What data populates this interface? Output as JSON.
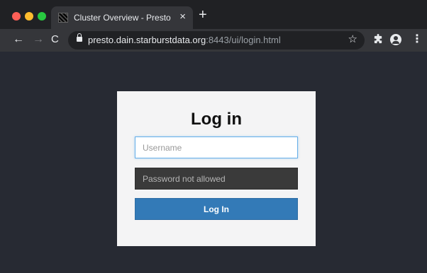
{
  "browser": {
    "tab": {
      "title": "Cluster Overview - Presto",
      "close_glyph": "×"
    },
    "new_tab_glyph": "+",
    "nav": {
      "back_glyph": "←",
      "forward_glyph": "→",
      "reload_glyph": "C"
    },
    "address": {
      "host": "presto.dain.starburstdata.org",
      "path": ":8443/ui/login.html"
    },
    "bookmark_glyph": "☆",
    "menu_glyph": "⋮"
  },
  "login": {
    "title": "Log in",
    "username_placeholder": "Username",
    "password_placeholder": "Password not allowed",
    "submit_label": "Log In"
  },
  "colors": {
    "page_background": "#272a33",
    "card_background": "#f4f4f5",
    "button_primary": "#337ab7",
    "disabled_field": "#3a3a3a"
  },
  "icons": [
    "favicon",
    "lock-icon",
    "star-icon",
    "extensions-icon",
    "profile-icon",
    "menu-icon"
  ]
}
